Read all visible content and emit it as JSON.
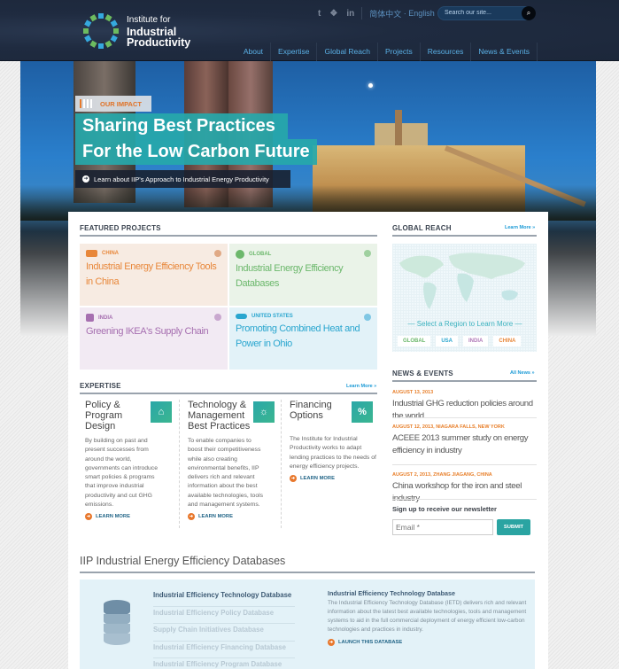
{
  "header": {
    "logo": {
      "line1": "Institute for",
      "line2": "Industrial",
      "line3": "Productivity"
    },
    "social": [
      {
        "name": "twitter-icon",
        "glyph": "t"
      },
      {
        "name": "weibo-icon",
        "glyph": "❖"
      },
      {
        "name": "linkedin-icon",
        "glyph": "in"
      }
    ],
    "languages": {
      "chinese": "简体中文",
      "separator": " · ",
      "english": "English"
    },
    "search": {
      "placeholder": "Search our site...",
      "value": ""
    },
    "nav": [
      "About",
      "Expertise",
      "Global Reach",
      "Projects",
      "Resources",
      "News & Events"
    ]
  },
  "hero": {
    "badge": "OUR IMPACT",
    "headline_line1": "Sharing Best Practices",
    "headline_line2": "For the Low Carbon Future",
    "link": "Learn about IIP's Approach to Industrial Energy Productivity"
  },
  "featured": {
    "title": "FEATURED PROJECTS",
    "projects": [
      {
        "region": "CHINA",
        "title": "Industrial Energy Efficiency Tools in China",
        "color": "#e8873a",
        "bg": "#f7ebe2"
      },
      {
        "region": "GLOBAL",
        "title": "Industrial Energy Efficiency Databases",
        "color": "#6cb86c",
        "bg": "#eaf3e8"
      },
      {
        "region": "INDIA",
        "title": "Greening IKEA's Supply Chain",
        "color": "#a66fb0",
        "bg": "#f2eaf3"
      },
      {
        "region": "UNITED STATES",
        "title": "Promoting Combined Heat and Power in Ohio",
        "color": "#2aa6cf",
        "bg": "#e2f2f8"
      }
    ]
  },
  "global_reach": {
    "title": "GLOBAL REACH",
    "learn_more": "Learn More »",
    "select_text": "— Select a Region to Learn More —",
    "regions": [
      {
        "label": "GLOBAL",
        "color": "#6cb86c"
      },
      {
        "label": "USA",
        "color": "#2aa6cf"
      },
      {
        "label": "INDIA",
        "color": "#b07ab8"
      },
      {
        "label": "CHINA",
        "color": "#e8873a"
      }
    ]
  },
  "expertise": {
    "title": "EXPERTISE",
    "learn_more": "Learn More »",
    "items": [
      {
        "title": "Policy & Program Design",
        "icon": "bank-icon",
        "glyph": "🏛",
        "body": "By building on past and present successes from around the world, governments can introduce smart policies & programs that improve industrial productivity and cut GHG emissions.",
        "link": "LEARN MORE"
      },
      {
        "title": "Technology & Management Best Practices",
        "icon": "lightbulb-icon",
        "glyph": "☼",
        "body": "To enable companies to boost their competitiveness while also creating environmental benefits, IIP delivers rich and relevant information about the best available technologies, tools and management systems.",
        "link": "LEARN MORE"
      },
      {
        "title": "Financing Options",
        "icon": "percent-icon",
        "glyph": "%",
        "body": "The Institute for Industrial Productivity works to adapt lending practices to the needs of energy efficiency projects.",
        "link": "LEARN MORE"
      }
    ]
  },
  "news": {
    "title": "NEWS & EVENTS",
    "all_news": "All News »",
    "items": [
      {
        "date": "AUGUST 13, 2013",
        "title": "Industrial GHG reduction policies around the world"
      },
      {
        "date": "AUGUST 12, 2013, NIAGARA FALLS, NEW YORK",
        "title": "ACEEE 2013 summer study on energy efficiency in industry"
      },
      {
        "date": "AUGUST 2, 2013, ZHANG JIAGANG, CHINA",
        "title": "China workshop for the iron and steel industry"
      }
    ],
    "newsletter_label": "Sign up to receive our newsletter",
    "email_placeholder": "Email *",
    "submit": "SUBMIT"
  },
  "databases": {
    "title": "IIP Industrial Energy Efficiency Databases",
    "list": [
      "Industrial Efficiency Technology Database",
      "Industrial Efficiency Policy Database",
      "Supply Chain Initiatives Database",
      "Industrial Efficiency Financing Database",
      "Industrial Efficiency Program Database"
    ],
    "selected_index": 0,
    "detail_title": "Industrial Efficiency Technology Database",
    "detail_body": "The Industrial Efficiency Technology Database (IETD) delivers rich and relevant information about the latest best available technologies, tools and management systems to aid in the full commercial deployment of energy efficient low-carbon technologies and practices in industry.",
    "launch": "LAUNCH THIS DATABASE"
  }
}
